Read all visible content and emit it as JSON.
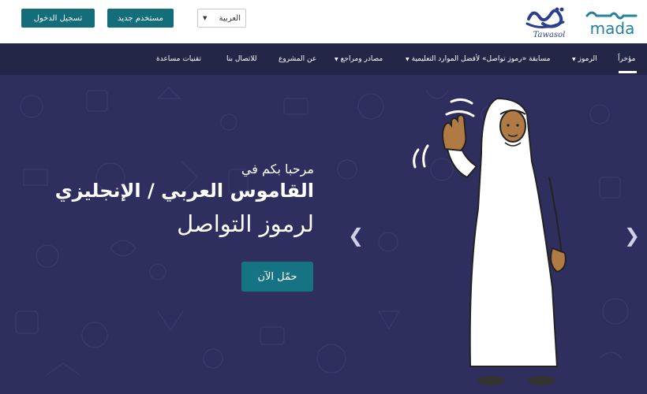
{
  "header": {
    "login_label": "تسجيل الدخول",
    "register_label": "مستخدم جديد",
    "language": "العربية",
    "logo_tawasol_text": "تواصل",
    "logo_tawasol_latin": "Tawasol",
    "logo_mada_arabic": "مدى",
    "logo_mada_latin": "mada"
  },
  "nav": {
    "items": [
      {
        "label": "مؤخراً"
      },
      {
        "label": "الرموز"
      },
      {
        "label": "مسابقة «رموز تواصل» لأفضل الموارد التعليمية"
      },
      {
        "label": "مصادر ومراجع"
      },
      {
        "label": "عن المشروع"
      },
      {
        "label": "للاتصال بنا"
      },
      {
        "label": "تقنيات مساعدة"
      }
    ]
  },
  "hero": {
    "welcome": "مرحبا بكم في",
    "headline": "القاموس العربي / الإنجليزي",
    "subline": "لرموز التواصل",
    "cta_label": "حمّل الآن"
  },
  "colors": {
    "brand_teal": "#146d7a",
    "nav_bg": "#242648",
    "hero_bg": "#2f2f5f"
  }
}
